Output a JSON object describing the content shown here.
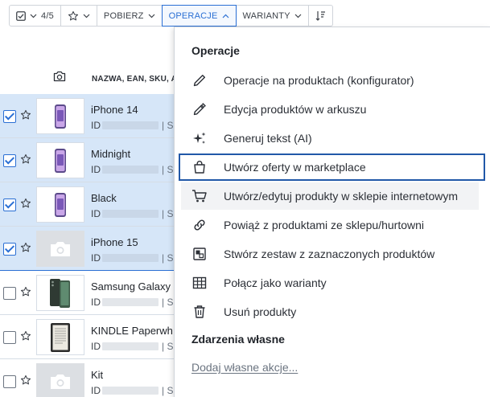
{
  "toolbar": {
    "selection_count": "4/5",
    "download_label": "POBIERZ",
    "operations_label": "OPERACJE",
    "variants_label": "WARIANTY"
  },
  "table": {
    "name_column_header": "NAZWA, EAN, SKU, A",
    "rows": [
      {
        "name": "iPhone 14",
        "id_prefix": "ID",
        "id_tail": "| S",
        "selected": true,
        "thumb": "phone-image"
      },
      {
        "name": "Midnight",
        "id_prefix": "ID",
        "id_tail": "| S",
        "selected": true,
        "thumb": "phone-image"
      },
      {
        "name": "Black",
        "id_prefix": "ID",
        "id_tail": "| S",
        "selected": true,
        "thumb": "phone-image"
      },
      {
        "name": "iPhone 15",
        "id_prefix": "ID",
        "id_tail": "| S",
        "selected": true,
        "thumb": "camera-placeholder"
      },
      {
        "name": "Samsung Galaxy",
        "id_prefix": "ID",
        "id_tail": "| S",
        "selected": false,
        "thumb": "samsung-image"
      },
      {
        "name": "KINDLE Paperwh",
        "id_prefix": "ID",
        "id_tail": "| S",
        "selected": false,
        "thumb": "kindle-image"
      },
      {
        "name": "Kit",
        "id_prefix": "ID",
        "id_tail": "| S",
        "selected": false,
        "thumb": "camera-placeholder"
      }
    ]
  },
  "menu": {
    "section_operations": "Operacje",
    "items": [
      {
        "label": "Operacje na produktach (konfigurator)",
        "icon": "pencil-line-icon"
      },
      {
        "label": "Edycja produktów w arkuszu",
        "icon": "pencil-icon"
      },
      {
        "label": "Generuj tekst (AI)",
        "icon": "sparkles-icon"
      },
      {
        "label": "Utwórz oferty w marketplace",
        "icon": "shopping-bag-icon"
      },
      {
        "label": "Utwórz/edytuj produkty w sklepie internetowym",
        "icon": "cart-icon"
      },
      {
        "label": "Powiąż z produktami ze sklepu/hurtowni",
        "icon": "link-icon"
      },
      {
        "label": "Stwórz zestaw z zaznaczonych produktów",
        "icon": "bundle-icon"
      },
      {
        "label": "Połącz jako warianty",
        "icon": "grid-icon"
      },
      {
        "label": "Usuń produkty",
        "icon": "trash-icon"
      }
    ],
    "section_custom": "Zdarzenia własne",
    "add_custom_action": "Dodaj własne akcje..."
  },
  "colors": {
    "accent": "#2a6fd4",
    "highlight_border": "#2158a8",
    "selected_row": "#d6e6f8"
  }
}
